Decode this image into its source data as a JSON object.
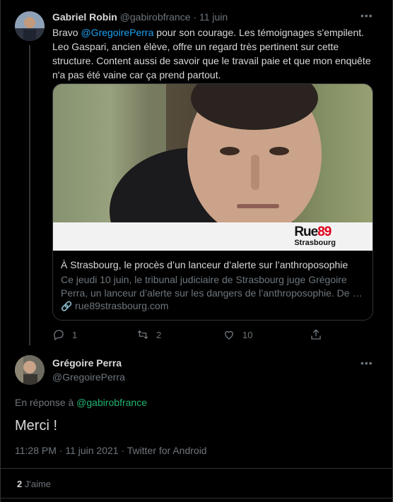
{
  "reply_tweet": {
    "author_name": "Gabriel Robin",
    "author_handle": "@gabirobfrance",
    "separator": "·",
    "date": "11 juin",
    "text_before": "Bravo ",
    "mention": "@GregoirePerra",
    "text_after": " pour son courage. Les témoignages s'empilent. Leo Gaspari, ancien élève, offre un regard très pertinent sur cette structure. Content aussi de savoir que le travail paie et que mon enquête n'a pas été vaine car ça prend partout.",
    "more_icon": "more-horizontal-icon",
    "card": {
      "logo_main": "Rue89",
      "logo_sub": "Strasbourg",
      "title": "À Strasbourg, le procès d’un lanceur d’alerte sur l’anthroposophie",
      "description": "Ce jeudi 10 juin, le tribunal judiciaire de Strasbourg juge Grégoire Perra, un lanceur d’alerte sur les dangers de l’anthroposophie. De …",
      "url": "rue89strasbourg.com"
    },
    "actions": {
      "reply_count": "1",
      "retweet_count": "2",
      "like_count": "10"
    }
  },
  "main_tweet": {
    "author_name": "Grégoire Perra",
    "author_handle": "@GregoirePerra",
    "in_reply_to_label": "En réponse à ",
    "in_reply_to_handle": "@gabirobfrance",
    "text": "Merci !",
    "timestamp": "11:28 PM · 11 juin 2021 · Twitter for Android",
    "likes_count": "2",
    "likes_label": "J'aime"
  },
  "colors": {
    "background": "#000000",
    "text": "#d9d9d9",
    "muted": "#6e767d",
    "link_blue": "#1da1f2",
    "link_green": "#1fb370",
    "logo_red": "#e2001a"
  }
}
